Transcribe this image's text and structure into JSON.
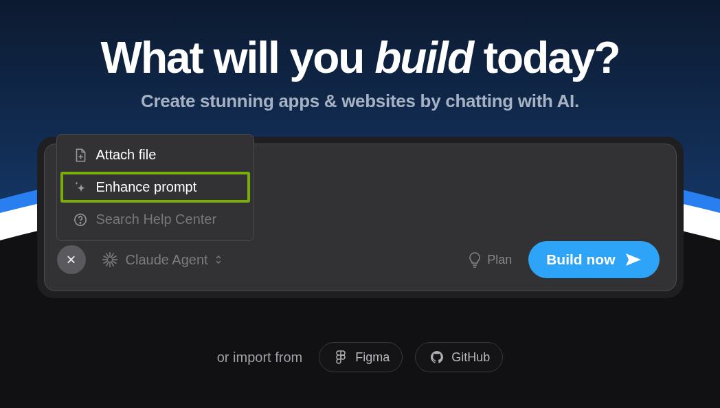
{
  "hero": {
    "title": "What will you *build* today?",
    "subtitle": "Create stunning apps & websites by chatting with AI."
  },
  "prompt_box": {
    "menu": [
      {
        "kind": "file",
        "label": "Attach file",
        "selected": false,
        "disabled": false
      },
      {
        "kind": "sparkle",
        "label": "Enhance prompt",
        "selected": true,
        "disabled": false
      },
      {
        "kind": "help",
        "label": "Search Help Center",
        "selected": false,
        "disabled": true
      }
    ],
    "close_button": "×",
    "agent": {
      "label": "Claude Agent"
    },
    "plan": {
      "label": "Plan"
    },
    "build_button": {
      "label": "Build now"
    }
  },
  "import": {
    "label": "or import from",
    "sources": [
      {
        "kind": "figma",
        "label": "Figma"
      },
      {
        "kind": "github",
        "label": "GitHub"
      }
    ]
  }
}
